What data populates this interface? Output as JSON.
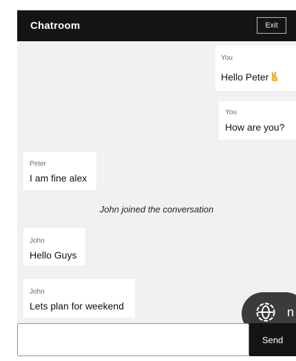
{
  "header": {
    "title": "Chatroom",
    "exit_label": "Exit"
  },
  "messages": [
    {
      "sender": "You",
      "text": "Hello Peter",
      "emoji": "victory-hand-icon"
    },
    {
      "sender": "You",
      "text": "How are you?"
    },
    {
      "sender": "Peter",
      "text": "I am fine alex"
    },
    {
      "system": "John joined the conversation"
    },
    {
      "sender": "John",
      "text": "Hello Guys"
    },
    {
      "sender": "John",
      "text": "Lets plan for weekend"
    }
  ],
  "overlay": {
    "icon": "globe-icon",
    "letter": "n"
  },
  "composer": {
    "placeholder": "",
    "value": "",
    "send_label": "Send"
  },
  "colors": {
    "header_bg": "#141414",
    "chat_bg": "#f1f1f1",
    "bubble_bg": "#ffffff",
    "send_bg": "#141414"
  }
}
